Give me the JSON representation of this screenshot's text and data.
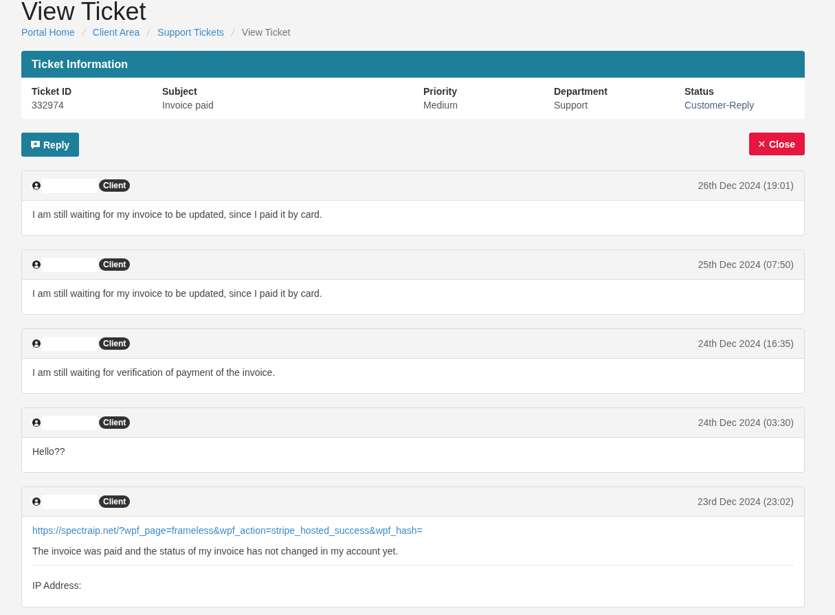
{
  "page": {
    "title": "View Ticket"
  },
  "breadcrumb": [
    {
      "label": "Portal Home",
      "kind": "link"
    },
    {
      "label": "Client Area",
      "kind": "link"
    },
    {
      "label": "Support Tickets",
      "kind": "link"
    },
    {
      "label": "View Ticket",
      "kind": "current"
    }
  ],
  "ticket_information": {
    "title": "Ticket Information",
    "fields": [
      {
        "label": "Ticket ID",
        "value": "332974"
      },
      {
        "label": "Subject",
        "value": "Invoice paid"
      },
      {
        "label": "Priority",
        "value": "Medium"
      },
      {
        "label": "Department",
        "value": "Support"
      },
      {
        "label": "Status",
        "value": "Customer-Reply",
        "color": "#4f5d87"
      }
    ]
  },
  "actions": [
    {
      "label": "Reply",
      "kind": "reply"
    },
    {
      "label": "Close",
      "kind": "close"
    }
  ],
  "messages": [
    {
      "name_redacted": true,
      "badge": "Client",
      "date": "26th Dec 2024 (19:01)",
      "body": [
        {
          "kind": "text",
          "text": "I am still waiting for my invoice to be updated, since I paid it by card."
        }
      ]
    },
    {
      "name_redacted": true,
      "badge": "Client",
      "date": "25th Dec 2024 (07:50)",
      "body": [
        {
          "kind": "text",
          "text": "I am still waiting for my invoice to be updated, since I paid it by card."
        }
      ]
    },
    {
      "name_redacted": true,
      "badge": "Client",
      "date": "24th Dec 2024 (16:35)",
      "body": [
        {
          "kind": "text",
          "text": "I am still waiting for verification of payment of the invoice."
        }
      ]
    },
    {
      "name_redacted": true,
      "badge": "Client",
      "date": "24th Dec 2024 (03:30)",
      "body": [
        {
          "kind": "text",
          "text": "Hello??"
        }
      ]
    },
    {
      "name_redacted": true,
      "badge": "Client",
      "date": "23rd Dec 2024 (23:02)",
      "body": [
        {
          "kind": "link",
          "text": "https://spectraip.net/?wpf_page=frameless&wpf_action=stripe_hosted_success&wpf_hash="
        },
        {
          "kind": "text",
          "text": "The invoice was paid and the status of my invoice has not changed in my account yet."
        }
      ],
      "ip_label": "IP Address:"
    }
  ]
}
